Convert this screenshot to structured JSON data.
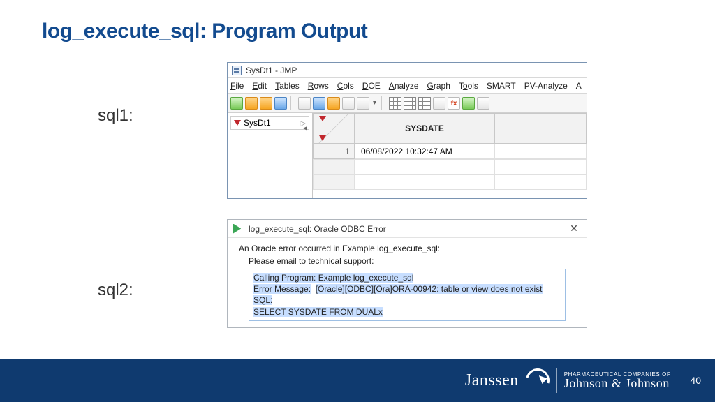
{
  "slide": {
    "title": "log_execute_sql: Program Output",
    "label_sql1": "sql1:",
    "label_sql2": "sql2:",
    "page_number": "40"
  },
  "jmp": {
    "window_title": "SysDt1 - JMP",
    "menu": [
      "File",
      "Edit",
      "Tables",
      "Rows",
      "Cols",
      "DOE",
      "Analyze",
      "Graph",
      "Tools",
      "SMART",
      "PV-Analyze",
      "A"
    ],
    "panel_name": "SysDt1",
    "column_header": "SYSDATE",
    "row_index": "1",
    "cell_value": "06/08/2022 10:32:47 AM"
  },
  "dialog": {
    "title": "log_execute_sql: Oracle ODBC Error",
    "intro": "An Oracle error occurred in Example log_execute_sql:",
    "subhead": "Please email to technical support:",
    "line1": "Calling Program: Example log_execute_sql",
    "line2_label": "Error Message:",
    "line2_msg": "[Oracle][ODBC][Ora]ORA-00942: table or view does not exist",
    "line3": "SQL:",
    "line4": "SELECT SYSDATE FROM DUALx"
  },
  "footer": {
    "brand": "Janssen",
    "tagline_top": "PHARMACEUTICAL COMPANIES OF",
    "tagline_script": "Johnson & Johnson"
  }
}
